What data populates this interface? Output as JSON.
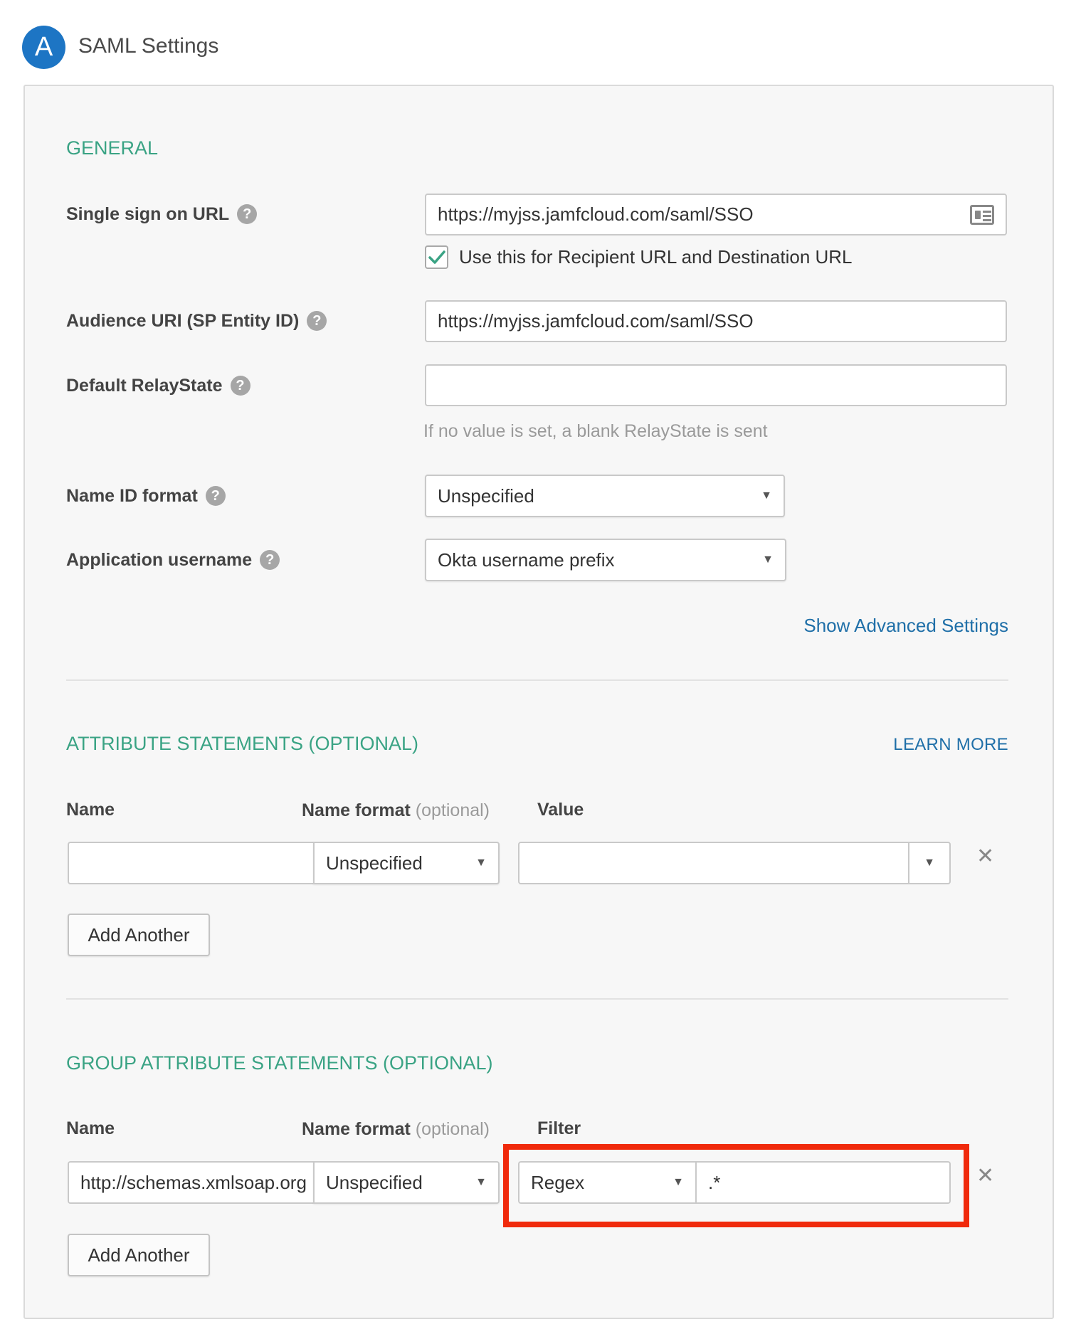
{
  "header": {
    "step_number": "A",
    "title": "SAML Settings"
  },
  "general": {
    "heading": "GENERAL",
    "sso_url": {
      "label": "Single sign on URL",
      "value": "https://myjss.jamfcloud.com/saml/SSO"
    },
    "recipient_checkbox": {
      "label": "Use this for Recipient URL and Destination URL",
      "checked": true
    },
    "audience_uri": {
      "label": "Audience URI (SP Entity ID)",
      "value": "https://myjss.jamfcloud.com/saml/SSO"
    },
    "relay_state": {
      "label": "Default RelayState",
      "value": "",
      "hint": "If no value is set, a blank RelayState is sent"
    },
    "name_id_format": {
      "label": "Name ID format",
      "value": "Unspecified"
    },
    "app_username": {
      "label": "Application username",
      "value": "Okta username prefix"
    },
    "advanced_link": "Show Advanced Settings"
  },
  "attributes": {
    "heading": "ATTRIBUTE STATEMENTS (OPTIONAL)",
    "learn_more": "LEARN MORE",
    "col_name": "Name",
    "col_format": "Name format",
    "col_format_optional": "(optional)",
    "col_value": "Value",
    "row": {
      "name": "",
      "format": "Unspecified",
      "value": ""
    },
    "add_button": "Add Another"
  },
  "groups": {
    "heading": "GROUP ATTRIBUTE STATEMENTS (OPTIONAL)",
    "col_name": "Name",
    "col_format": "Name format",
    "col_format_optional": "(optional)",
    "col_filter": "Filter",
    "row": {
      "name": "http://schemas.xmlsoap.org",
      "format": "Unspecified",
      "filter_type": "Regex",
      "filter_value": ".*"
    },
    "add_button": "Add Another"
  },
  "icons": {
    "help": "?",
    "caret": "▼",
    "remove": "✕"
  },
  "colors": {
    "accent_green": "#3aa384",
    "link_blue": "#1f6fa8",
    "step_blue": "#1d75c4",
    "highlight_red": "#f02a0c"
  }
}
